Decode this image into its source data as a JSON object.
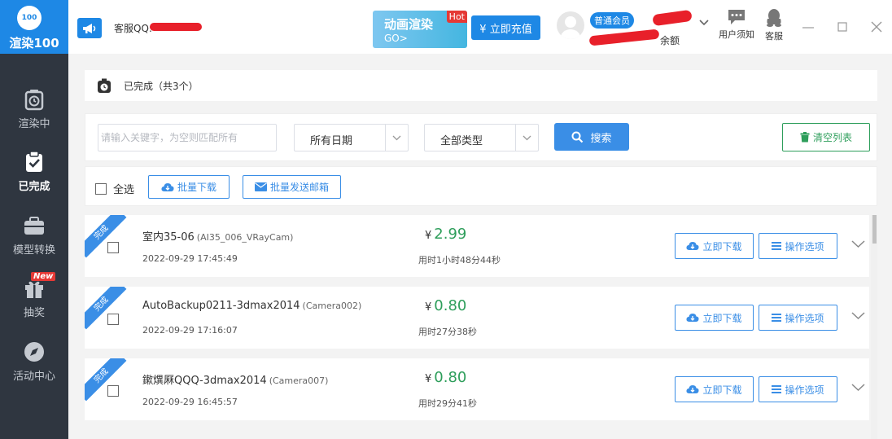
{
  "app": {
    "logo_badge": "100",
    "logo_text": "渲染100"
  },
  "sidebar": {
    "items": [
      {
        "label": "渲染中",
        "icon": "stopwatch-icon"
      },
      {
        "label": "已完成",
        "icon": "clipboard-check-icon",
        "active": true
      },
      {
        "label": "模型转换",
        "icon": "briefcase-icon"
      },
      {
        "label": "抽奖",
        "icon": "gift-icon",
        "badge": "New"
      },
      {
        "label": "活动中心",
        "icon": "compass-icon"
      }
    ]
  },
  "header": {
    "qq_label": "客服QQ:",
    "promo": {
      "title": "动画渲染",
      "go": "GO>",
      "hot": "Hot"
    },
    "recharge_label": "¥ 立即充值",
    "member_badge": "普通会员",
    "balance_label": "余额",
    "notice_label": "用户须知",
    "service_label": "客服"
  },
  "page": {
    "title": "已完成（共3个）"
  },
  "filters": {
    "search_placeholder": "请输入关键字，为空则匹配所有",
    "date_select": "所有日期",
    "type_select": "全部类型",
    "search_button": "搜索",
    "clear_button": "清空列表"
  },
  "batch": {
    "select_all": "全选",
    "download_button": "批量下载",
    "email_button": "批量发送邮箱"
  },
  "task_labels": {
    "status": "完成",
    "download": "立即下载",
    "options": "操作选项",
    "currency": "¥"
  },
  "tasks": [
    {
      "name": "室内35-06",
      "camera": "(AI35_006_VRayCam)",
      "date": "2022-09-29 17:45:49",
      "price": "2.99",
      "duration": "用时1小时48分44秒"
    },
    {
      "name": "AutoBackup0211-3dmax2014",
      "camera": "(Camera002)",
      "date": "2022-09-29 17:16:07",
      "price": "0.80",
      "duration": "用时27分38秒"
    },
    {
      "name": "鏉熼厤QQQ-3dmax2014",
      "camera": "(Camera007)",
      "date": "2022-09-29 16:45:57",
      "price": "0.80",
      "duration": "用时29分41秒"
    }
  ],
  "colors": {
    "accent": "#1e88e5",
    "sidebar": "#2f3640",
    "price": "#2e9e5b",
    "clear": "#2e9e5b",
    "badge_new": "#e53935"
  }
}
